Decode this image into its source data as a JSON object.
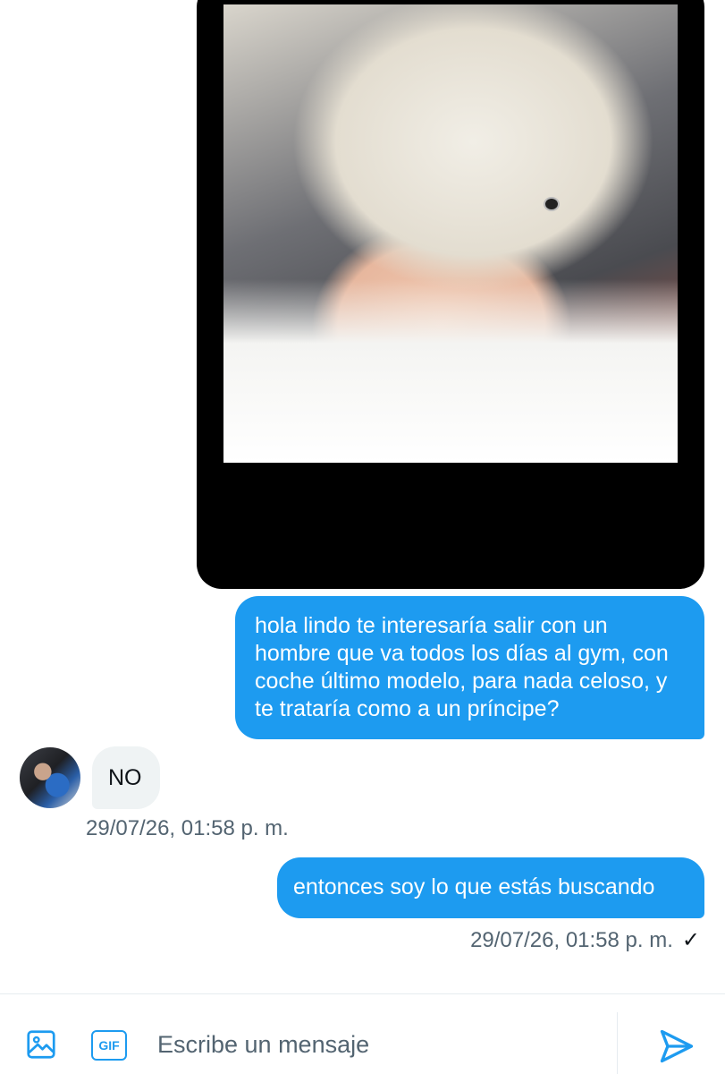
{
  "conversation": {
    "messages": [
      {
        "type": "image",
        "direction": "sent",
        "alt": ""
      },
      {
        "type": "text",
        "direction": "sent",
        "text": "hola lindo te interesaría salir con un hombre que va todos los días al gym, con coche último modelo, para nada celoso, y te trataría como a un príncipe?"
      },
      {
        "type": "text",
        "direction": "received",
        "text": "NO",
        "timestamp": "29/07/26, 01:58 p. m."
      },
      {
        "type": "text",
        "direction": "sent",
        "text": "entonces soy lo que estás buscando",
        "timestamp": "29/07/26, 01:58 p. m.",
        "status_icon": "check-icon"
      }
    ]
  },
  "composer": {
    "placeholder": "Escribe un mensaje",
    "gif_label": "GIF",
    "icons": [
      "image-icon",
      "gif-icon",
      "send-icon"
    ]
  },
  "colors": {
    "accent": "#1d9bf0",
    "received_bubble": "#eff3f4",
    "muted_text": "#536471"
  }
}
